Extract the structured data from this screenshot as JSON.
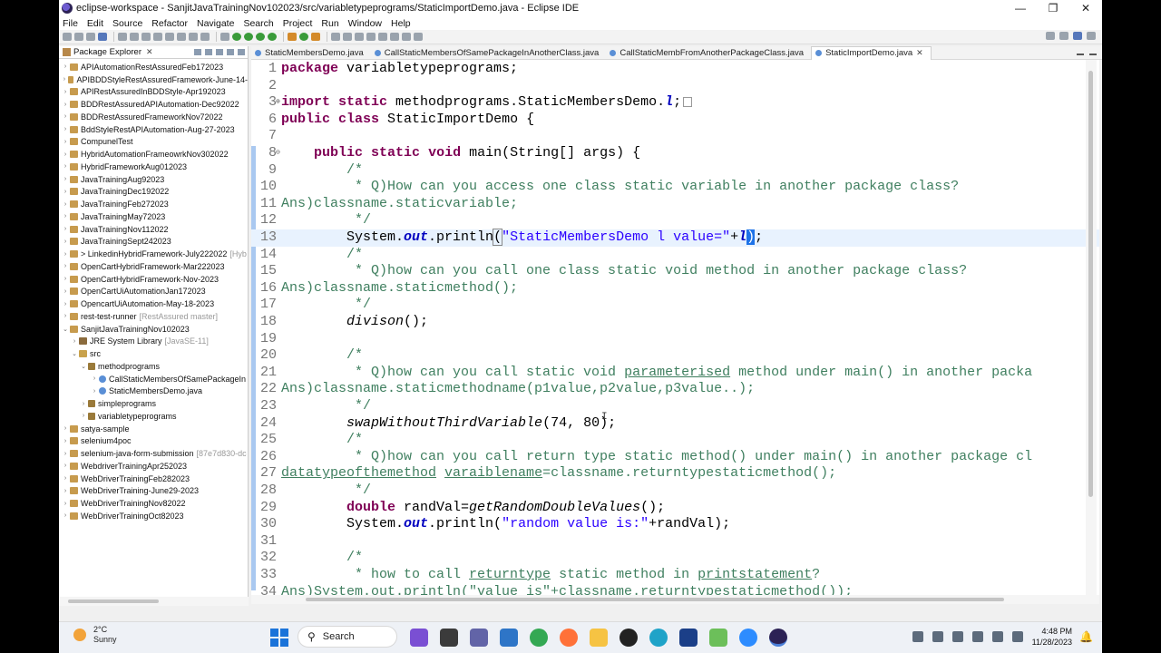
{
  "window": {
    "title": "eclipse-workspace - SanjitJavaTrainingNov102023/src/variabletypeprograms/StaticImportDemo.java - Eclipse IDE",
    "controls": [
      "—",
      "❐",
      "✕"
    ]
  },
  "menu": [
    "File",
    "Edit",
    "Source",
    "Refactor",
    "Navigate",
    "Search",
    "Project",
    "Run",
    "Window",
    "Help"
  ],
  "explorer": {
    "title": "Package Explorer",
    "items": [
      {
        "label": "APIAutomationRestAssuredFeb172023",
        "level": 0,
        "type": "project"
      },
      {
        "label": "APIBDDStyleRestAssuredFramework-June-14-",
        "level": 0,
        "type": "project"
      },
      {
        "label": "APIRestAssuredInBDDStyle-Apr192023",
        "level": 0,
        "type": "project"
      },
      {
        "label": "BDDRestAssuredAPIAutomation-Dec92022",
        "level": 0,
        "type": "project"
      },
      {
        "label": "BDDRestAssuredFrameworkNov72022",
        "level": 0,
        "type": "project"
      },
      {
        "label": "BddStyleRestAPIAutomation-Aug-27-2023",
        "level": 0,
        "type": "project"
      },
      {
        "label": "CompunelTest",
        "level": 0,
        "type": "project"
      },
      {
        "label": "HybridAutomationFrameowrkNov302022",
        "level": 0,
        "type": "project"
      },
      {
        "label": "HybridFrameworkAug012023",
        "level": 0,
        "type": "project"
      },
      {
        "label": "JavaTrainingAug92023",
        "level": 0,
        "type": "project"
      },
      {
        "label": "JavaTrainingDec192022",
        "level": 0,
        "type": "project"
      },
      {
        "label": "JavaTrainingFeb272023",
        "level": 0,
        "type": "project"
      },
      {
        "label": "JavaTrainingMay72023",
        "level": 0,
        "type": "project"
      },
      {
        "label": "JavaTrainingNov112022",
        "level": 0,
        "type": "project"
      },
      {
        "label": "JavaTrainingSept242023",
        "level": 0,
        "type": "project"
      },
      {
        "label": "> LinkedinHybridFramework-July222022",
        "level": 0,
        "type": "project",
        "decoration": "[Hyb"
      },
      {
        "label": "OpenCartHybridFramework-Mar222023",
        "level": 0,
        "type": "project"
      },
      {
        "label": "OpenCartHybridFramework-Nov-2023",
        "level": 0,
        "type": "project"
      },
      {
        "label": "OpenCartUiAutomationJan172023",
        "level": 0,
        "type": "project"
      },
      {
        "label": "OpencartUiAutomation-May-18-2023",
        "level": 0,
        "type": "project"
      },
      {
        "label": "rest-test-runner",
        "level": 0,
        "type": "project",
        "decoration": "[RestAssured master]"
      },
      {
        "label": "SanjitJavaTrainingNov102023",
        "level": 0,
        "type": "project",
        "expanded": true
      },
      {
        "label": "JRE System Library",
        "level": 1,
        "type": "jar",
        "decoration": "[JavaSE-11]"
      },
      {
        "label": "src",
        "level": 1,
        "type": "src",
        "expanded": true
      },
      {
        "label": "methodprograms",
        "level": 2,
        "type": "pkg",
        "expanded": true
      },
      {
        "label": "CallStaticMembersOfSamePackageIn",
        "level": 3,
        "type": "java"
      },
      {
        "label": "StaticMembersDemo.java",
        "level": 3,
        "type": "java"
      },
      {
        "label": "simpleprograms",
        "level": 2,
        "type": "pkg"
      },
      {
        "label": "variabletypeprograms",
        "level": 2,
        "type": "pkg"
      },
      {
        "label": "satya-sample",
        "level": 0,
        "type": "project"
      },
      {
        "label": "selenium4poc",
        "level": 0,
        "type": "project"
      },
      {
        "label": "selenium-java-form-submission",
        "level": 0,
        "type": "project",
        "decoration": "[87e7d830-dc"
      },
      {
        "label": "WebdriverTrainingApr252023",
        "level": 0,
        "type": "project"
      },
      {
        "label": "WebDriverTrainingFeb282023",
        "level": 0,
        "type": "project"
      },
      {
        "label": "WebDriverTraining-June29-2023",
        "level": 0,
        "type": "project"
      },
      {
        "label": "WebDriverTrainingNov82022",
        "level": 0,
        "type": "project"
      },
      {
        "label": "WebDriverTrainingOct82023",
        "level": 0,
        "type": "project"
      }
    ]
  },
  "editor_tabs": [
    {
      "label": "StaticMembersDemo.java",
      "active": false
    },
    {
      "label": "CallStaticMembersOfSamePackageInAnotherClass.java",
      "active": false
    },
    {
      "label": "CallStaticMembFromAnotherPackageClass.java",
      "active": false
    },
    {
      "label": "StaticImportDemo.java",
      "active": true
    }
  ],
  "code": {
    "l1": {
      "num": "1",
      "kw": "package",
      "rest": " variabletypeprograms;"
    },
    "l2": {
      "num": "2"
    },
    "l3": {
      "num": "3",
      "kw1": "import",
      "kw2": "static",
      "rest": " methodprograms.StaticMembersDemo.",
      "fld": "l",
      "tail": ";"
    },
    "l6": {
      "num": "6",
      "kw1": "public",
      "kw2": "class",
      "rest": " StaticImportDemo {"
    },
    "l7": {
      "num": "7"
    },
    "l8": {
      "num": "8",
      "kw1": "public",
      "kw2": "static",
      "kw3": "void",
      "rest": " main(String[] args) {"
    },
    "l9": {
      "num": "9",
      "cm": "/*"
    },
    "l10": {
      "num": "10",
      "cm": "* Q)How can you access one class static variable in another package class?"
    },
    "l11": {
      "num": "11",
      "cm": "Ans)classname.staticvariable;"
    },
    "l12": {
      "num": "12",
      "cm": "*/"
    },
    "l13": {
      "num": "13",
      "pre": "System.",
      "fld": "out",
      "mid": ".println",
      "paren": "(",
      "st": "\"StaticMembersDemo l value=\"",
      "plus": "+",
      "var": "l",
      "close": ")",
      "tail": ";"
    },
    "l14": {
      "num": "14",
      "cm": "/*"
    },
    "l15": {
      "num": "15",
      "cm": "* Q)how can you call one class static void method in another package class?"
    },
    "l16": {
      "num": "16",
      "cm": "Ans)classname.staticmethod();"
    },
    "l17": {
      "num": "17",
      "cm": "*/"
    },
    "l18": {
      "num": "18",
      "call": "divison",
      "tail": "();"
    },
    "l19": {
      "num": "19"
    },
    "l20": {
      "num": "20",
      "cm": "/*"
    },
    "l21": {
      "num": "21",
      "cm1": "* Q)how can you call static void ",
      "ul": "parameterised",
      "cm2": " method under main() in another packa"
    },
    "l22": {
      "num": "22",
      "cm": "Ans)classname.staticmethodname(p1value,p2value,p3value..);"
    },
    "l23": {
      "num": "23",
      "cm": "*/"
    },
    "l24": {
      "num": "24",
      "call": "swapWithoutThirdVariable",
      "tail": "(74, 80);"
    },
    "l25": {
      "num": "25",
      "cm": "/*"
    },
    "l26": {
      "num": "26",
      "cm": "* Q)how can you call return type static method() under main() in another package cl"
    },
    "l27": {
      "num": "27",
      "ul1": "datatypeofthemethod",
      "sp": " ",
      "ul2": "varaiblename",
      "cm": "=classname.returntypestaticmethod();"
    },
    "l28": {
      "num": "28",
      "cm": "*/"
    },
    "l29": {
      "num": "29",
      "kw": "double",
      "rest": " randVal=",
      "call": "getRandomDoubleValues",
      "tail": "();"
    },
    "l30": {
      "num": "30",
      "pre": "System.",
      "fld": "out",
      "mid": ".println(",
      "st": "\"random value is:\"",
      "tail": "+randVal);"
    },
    "l31": {
      "num": "31"
    },
    "l32": {
      "num": "32",
      "cm": "/*"
    },
    "l33": {
      "num": "33",
      "cm1": "* how to call ",
      "ul1": "returntype",
      "cm2": " static method in ",
      "ul2": "printstatement",
      "cm3": "?"
    },
    "l34": {
      "num": "34",
      "cm": "Ans)System.out.println(\"value is\"+classname.returntypestaticmethod());"
    }
  },
  "taskbar": {
    "weather_temp": "2°C",
    "weather_desc": "Sunny",
    "search_label": "Search",
    "time": "4:48 PM",
    "date": "11/28/2023"
  },
  "colors": {
    "keyword": "#7f0055",
    "comment": "#3f7f5f",
    "string": "#2a00ff",
    "field": "#0000c0",
    "selection": "#1e73e8"
  }
}
